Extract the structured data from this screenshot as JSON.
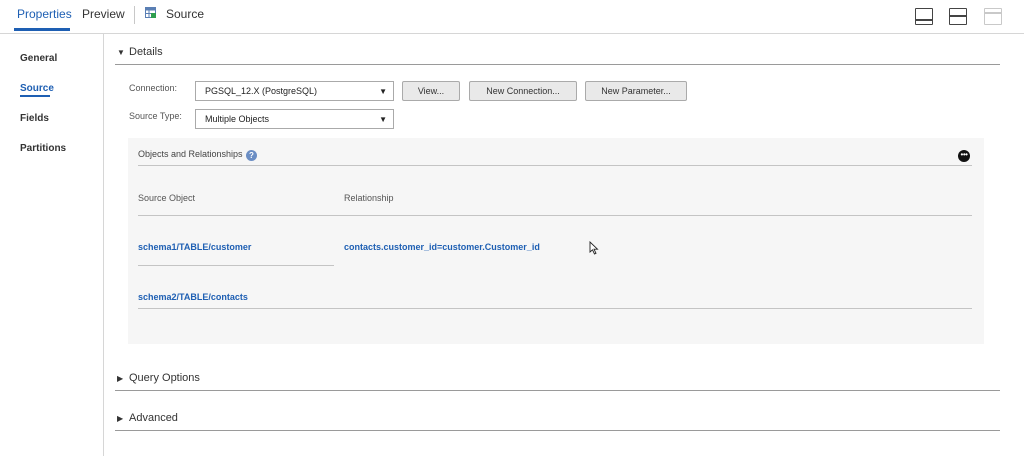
{
  "tabs": [
    {
      "label": "Properties",
      "active": true
    },
    {
      "label": "Preview",
      "active": false
    },
    {
      "label": "Source",
      "active": false
    }
  ],
  "layout_icons": [
    "panel-bottom-icon",
    "split-horizontal-icon",
    "panel-top-icon"
  ],
  "nav": {
    "items": [
      {
        "label": "General",
        "active": false
      },
      {
        "label": "Source",
        "active": true
      },
      {
        "label": "Fields",
        "active": false
      },
      {
        "label": "Partitions",
        "active": false
      }
    ]
  },
  "details": {
    "title": "Details",
    "connection": {
      "label": "Connection:",
      "value": "PGSQL_12.X (PostgreSQL)"
    },
    "buttons": {
      "view": "View...",
      "new_connection": "New Connection...",
      "new_parameter": "New Parameter..."
    },
    "source_type": {
      "label": "Source Type:",
      "value": "Multiple Objects"
    },
    "objects": {
      "title": "Objects and Relationships",
      "help_glyph": "?",
      "columns": {
        "source_object": "Source Object",
        "relationship": "Relationship"
      },
      "rows": [
        {
          "source_object": "schema1/TABLE/customer",
          "relationship": "contacts.customer_id=customer.Customer_id"
        },
        {
          "source_object": "schema2/TABLE/contacts",
          "relationship": ""
        }
      ]
    }
  },
  "sections": {
    "query_options": "Query Options",
    "advanced": "Advanced"
  },
  "colors": {
    "accent": "#1e5fb3",
    "help_icon": "#6b8ec4"
  }
}
